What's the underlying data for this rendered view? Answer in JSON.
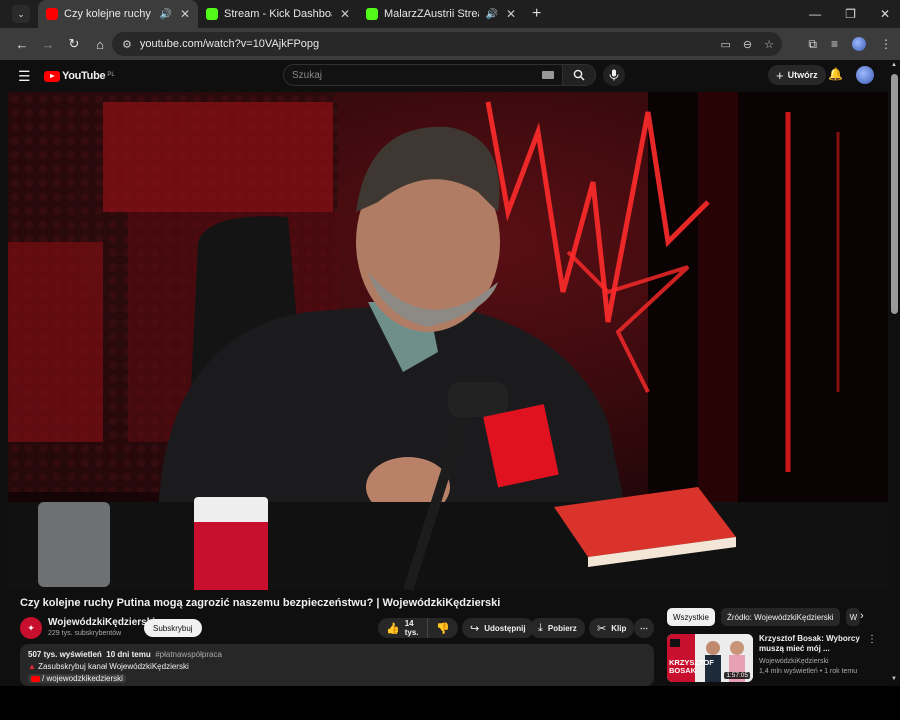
{
  "browser": {
    "tabs": [
      {
        "title": "Czy kolejne ruchy Putina mo",
        "favicon": "youtube-favicon",
        "audio": true,
        "active": true
      },
      {
        "title": "Stream - Kick Dashboard",
        "favicon": "kick-favicon",
        "audio": false,
        "active": false
      },
      {
        "title": "MalarzZAustrii Stream - Wa",
        "favicon": "kick-favicon",
        "audio": true,
        "active": false
      }
    ],
    "url": "youtube.com/watch?v=10VAjkFPopg"
  },
  "youtube": {
    "logo_text": "YouTube",
    "logo_country": "PL",
    "search_placeholder": "Szukaj",
    "create_label": "Utwórz"
  },
  "video": {
    "title": "Czy kolejne ruchy Putina mogą zagrozić naszemu bezpieczeństwu? | WojewódzkiKędzierski",
    "channel_name": "WojewódzkiKędzierski",
    "subscribers": "229 tys. subskrybentów",
    "subscribe_label": "Subskrybuj",
    "likes": "14 tys.",
    "share_label": "Udostępnij",
    "download_label": "Pobierz",
    "clip_label": "Klip"
  },
  "description": {
    "views": "507 tys. wyświetleń",
    "age": "10 dni temu",
    "hashtag": "#płatnawspółpraca",
    "line1": "Zasubskrybuj kanał WojewódzkiKędzierski",
    "line2": "/ wojewodzkikedzierski"
  },
  "sidebar": {
    "chips": [
      "Wszystkie",
      "Źródło: WojewódzkiKędzierski",
      "W"
    ],
    "recommendations": [
      {
        "title": "Krzysztof Bosak: Wyborcy muszą mieć mój ...",
        "channel": "WojewódzkiKędzierski",
        "meta": "1,4 mln wyświetleń • 1 rok temu",
        "duration": "1:57:05",
        "thumb_text_line1": "KRZYSZTOF",
        "thumb_text_line2": "BOSAK"
      }
    ]
  },
  "colors": {
    "youtube_red": "#ff0000",
    "kick_green": "#53fc18",
    "background": "#0f0f0f",
    "chip_bg": "#272727"
  }
}
